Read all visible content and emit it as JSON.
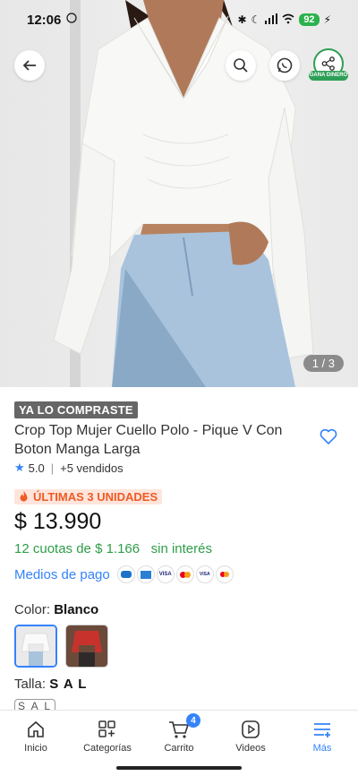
{
  "status": {
    "time": "12:06",
    "battery": "92"
  },
  "hero": {
    "counter": "1 / 3",
    "share_tag": "GANA DINERO"
  },
  "product": {
    "badge": "YA LO COMPRASTE",
    "title": "Crop Top Mujer Cuello Polo - Pique V Con Boton Manga Larga",
    "rating": "5.0",
    "sold": "+5 vendidos",
    "stock_badge": "ÚLTIMAS 3 UNIDADES",
    "price": "$ 13.990",
    "installments": "12 cuotas de $ 1.166   sin interés",
    "payment_link": "Medios de pago",
    "payment_icons": [
      "VISA",
      "VISA",
      "MC",
      "VISA",
      "MC"
    ],
    "color_label": "Color:",
    "color_value": "Blanco",
    "size_label": "Talla:",
    "size_value": "S A L",
    "size_option": "S A L"
  },
  "nav": {
    "items": [
      {
        "label": "Inicio",
        "icon": "home-icon"
      },
      {
        "label": "Categorías",
        "icon": "categories-icon"
      },
      {
        "label": "Carrito",
        "icon": "cart-icon",
        "badge": "4"
      },
      {
        "label": "Videos",
        "icon": "video-icon"
      },
      {
        "label": "Más",
        "icon": "menu-icon",
        "active": true
      }
    ]
  },
  "colors": {
    "accent": "#3483fa",
    "green": "#2d9e48",
    "orange": "#f05a24"
  }
}
